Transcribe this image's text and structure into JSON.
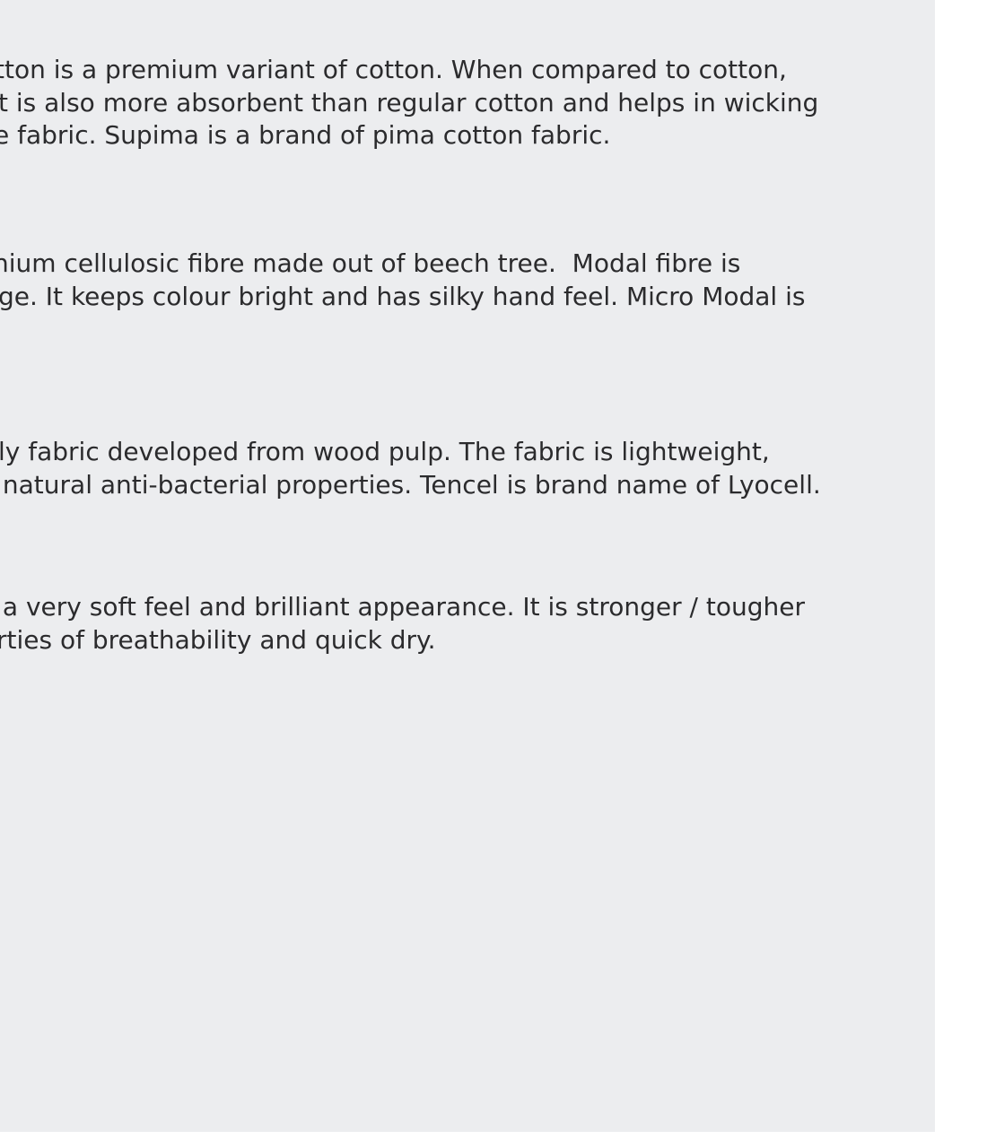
{
  "colors": {
    "panel_background": "#ecedef",
    "page_background": "#ffffff",
    "text": "#2b2b2d"
  },
  "paragraphs": [
    {
      "lines": [
        "tton is a premium variant of cotton. When compared to cotton,",
        "t is also more absorbent than regular cotton and helps in wicking",
        "e fabric. Supima is a brand of pima cotton fabric."
      ]
    },
    {
      "lines": [
        "nium cellulosic fibre made out of beech tree.  Modal fibre is",
        "ge. It keeps colour bright and has silky hand feel. Micro Modal is"
      ]
    },
    {
      "lines": [
        "ly fabric developed from wood pulp. The fabric is lightweight,",
        " natural anti-bacterial properties. Tencel is brand name of Lyocell."
      ]
    },
    {
      "lines": [
        " a very soft feel and brilliant appearance. It is stronger / tougher",
        "rties of breathability and quick dry."
      ]
    }
  ]
}
